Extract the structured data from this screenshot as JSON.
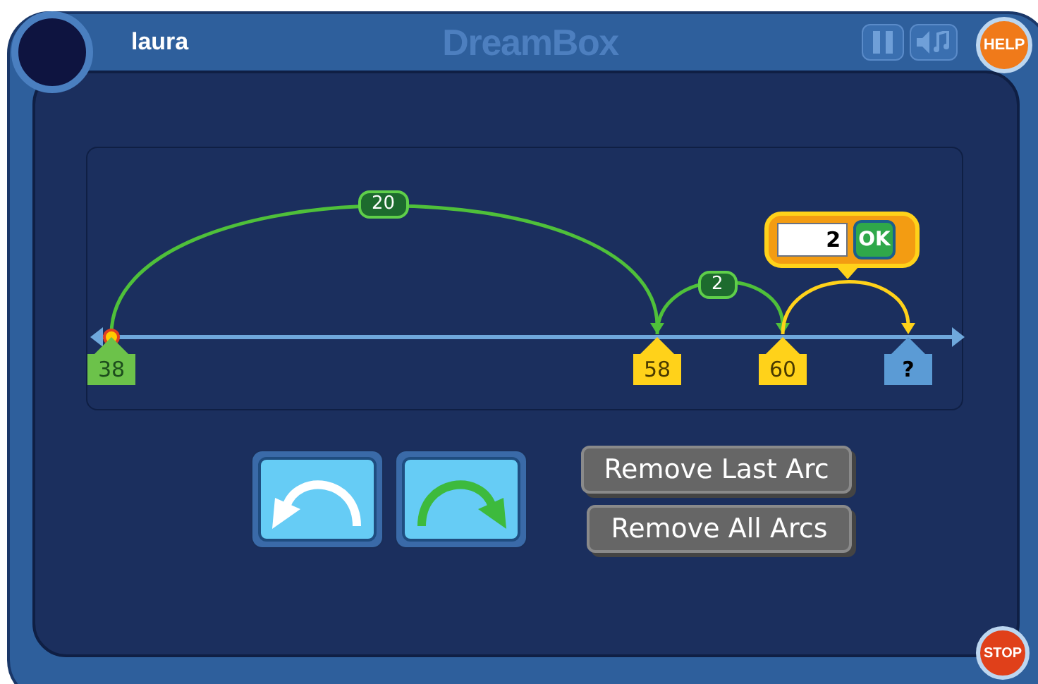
{
  "header": {
    "username": "laura",
    "logo": "DreamBox",
    "help": "HELP"
  },
  "number_line": {
    "markers": [
      {
        "label": "38",
        "kind": "start"
      },
      {
        "label": "58",
        "kind": "landed"
      },
      {
        "label": "60",
        "kind": "landed"
      },
      {
        "label": "?",
        "kind": "target"
      }
    ],
    "arcs": [
      {
        "label": "20",
        "kind": "done"
      },
      {
        "label": "2",
        "kind": "done"
      },
      {
        "kind": "pending"
      }
    ],
    "jump_input": {
      "value": "2",
      "button": "OK"
    }
  },
  "controls": {
    "remove_last": "Remove Last Arc",
    "remove_all": "Remove All Arcs"
  },
  "stop": "STOP"
}
